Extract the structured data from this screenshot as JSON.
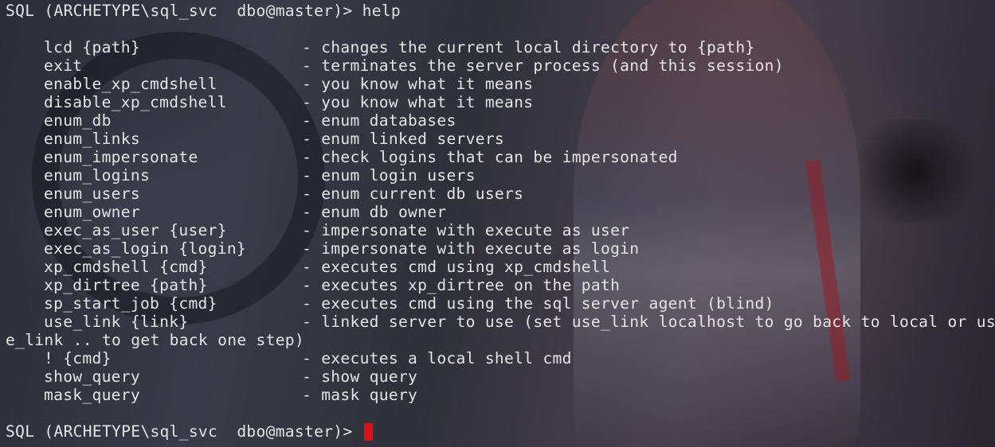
{
  "prompt": "SQL (ARCHETYPE\\sql_svc  dbo@master)>",
  "command": "help",
  "help": [
    {
      "cmd": "lcd {path}",
      "desc": "- changes the current local directory to {path}"
    },
    {
      "cmd": "exit",
      "desc": "- terminates the server process (and this session)"
    },
    {
      "cmd": "enable_xp_cmdshell",
      "desc": "- you know what it means"
    },
    {
      "cmd": "disable_xp_cmdshell",
      "desc": "- you know what it means"
    },
    {
      "cmd": "enum_db",
      "desc": "- enum databases"
    },
    {
      "cmd": "enum_links",
      "desc": "- enum linked servers"
    },
    {
      "cmd": "enum_impersonate",
      "desc": "- check logins that can be impersonated"
    },
    {
      "cmd": "enum_logins",
      "desc": "- enum login users"
    },
    {
      "cmd": "enum_users",
      "desc": "- enum current db users"
    },
    {
      "cmd": "enum_owner",
      "desc": "- enum db owner"
    },
    {
      "cmd": "exec_as_user {user}",
      "desc": "- impersonate with execute as user"
    },
    {
      "cmd": "exec_as_login {login}",
      "desc": "- impersonate with execute as login"
    },
    {
      "cmd": "xp_cmdshell {cmd}",
      "desc": "- executes cmd using xp_cmdshell"
    },
    {
      "cmd": "xp_dirtree {path}",
      "desc": "- executes xp_dirtree on the path"
    },
    {
      "cmd": "sp_start_job {cmd}",
      "desc": "- executes cmd using the sql server agent (blind)"
    },
    {
      "cmd": "use_link {link}",
      "desc": "- linked server to use (set use_link localhost to go back to local or us"
    },
    {
      "wrap": "e_link .. to get back one step)"
    },
    {
      "cmd": "! {cmd}",
      "desc": "- executes a local shell cmd"
    },
    {
      "cmd": "show_query",
      "desc": "- show query"
    },
    {
      "cmd": "mask_query",
      "desc": "- mask query"
    }
  ],
  "cursor_color": "#e0101a",
  "text_color": "#e4e4e4"
}
